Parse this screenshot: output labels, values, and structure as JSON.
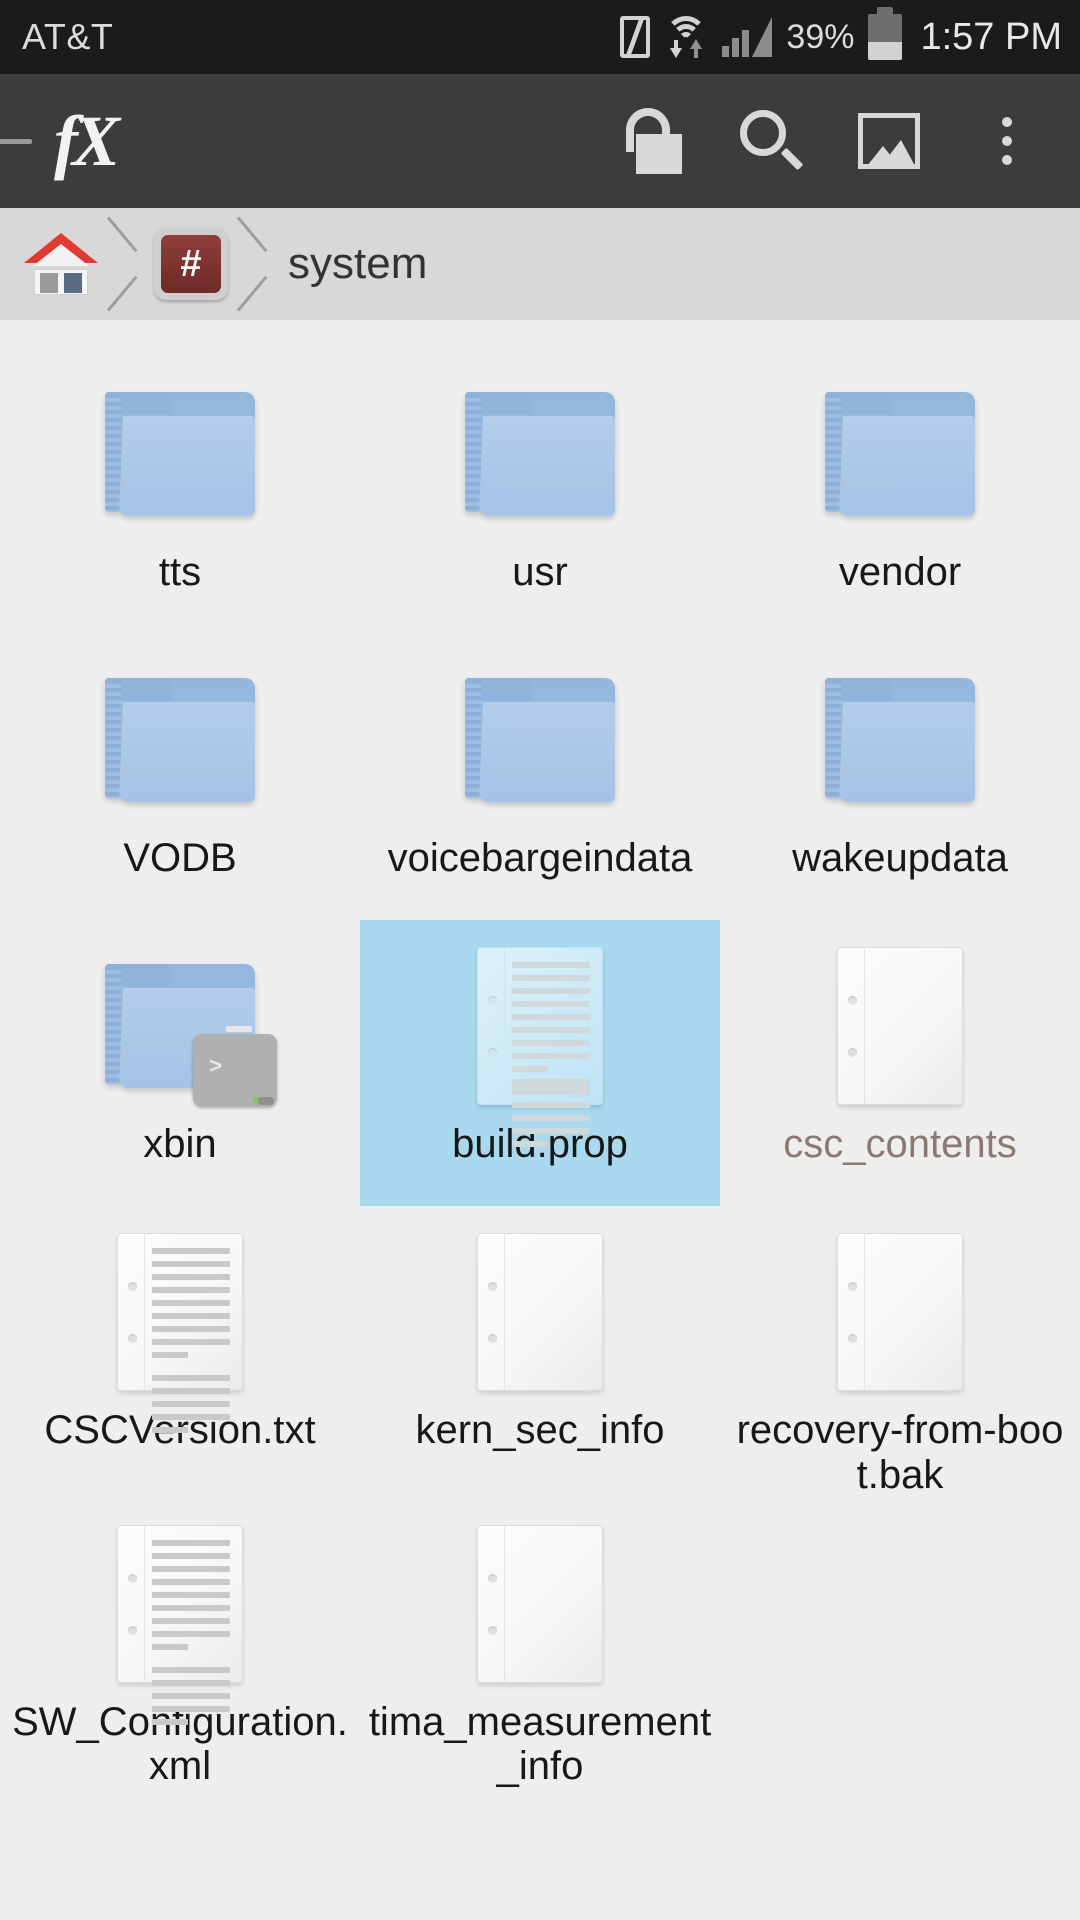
{
  "status_bar": {
    "carrier": "AT&T",
    "battery_percent_label": "39%",
    "battery_level": 39,
    "time": "1:57 PM",
    "icons": [
      "nfc-icon",
      "wifi-icon",
      "signal-icon",
      "battery-icon"
    ]
  },
  "toolbar": {
    "app_logo": "fX",
    "buttons": [
      {
        "name": "unlock-root-button",
        "icon": "unlock-icon"
      },
      {
        "name": "search-button",
        "icon": "search-icon"
      },
      {
        "name": "image-view-button",
        "icon": "image-icon"
      },
      {
        "name": "overflow-menu-button",
        "icon": "overflow-menu-icon"
      }
    ]
  },
  "breadcrumb": {
    "items": [
      {
        "name": "home-crumb",
        "icon": "home-icon",
        "label": ""
      },
      {
        "name": "root-crumb",
        "icon": "root-hash-icon",
        "label": "#"
      },
      {
        "name": "system-crumb",
        "icon": "",
        "label": "system"
      }
    ],
    "current_path_label": "system"
  },
  "colors": {
    "selection": "#a8d9ee",
    "status_bar": "#1b1b1b",
    "toolbar": "#3c3c3c",
    "breadcrumb": "#d8d8d8",
    "content_bg": "#eeeeee",
    "symlink_text": "#8a7a72"
  },
  "files": [
    {
      "name": "tts",
      "type": "folder",
      "selected": false,
      "muted": false
    },
    {
      "name": "usr",
      "type": "folder",
      "selected": false,
      "muted": false
    },
    {
      "name": "vendor",
      "type": "folder",
      "selected": false,
      "muted": false
    },
    {
      "name": "VODB",
      "type": "folder",
      "selected": false,
      "muted": false
    },
    {
      "name": "voicebargeindata",
      "type": "folder",
      "selected": false,
      "muted": false
    },
    {
      "name": "wakeupdata",
      "type": "folder",
      "selected": false,
      "muted": false
    },
    {
      "name": "xbin",
      "type": "folder-terminal",
      "selected": false,
      "muted": false
    },
    {
      "name": "build.prop",
      "type": "document-text",
      "selected": true,
      "muted": false
    },
    {
      "name": "csc_contents",
      "type": "document-blank",
      "selected": false,
      "muted": true
    },
    {
      "name": "CSCVersion.txt",
      "type": "document-text",
      "selected": false,
      "muted": false
    },
    {
      "name": "kern_sec_info",
      "type": "document-blank",
      "selected": false,
      "muted": false
    },
    {
      "name": "recovery-from-boot.bak",
      "type": "document-blank",
      "selected": false,
      "muted": false
    },
    {
      "name": "SW_Configuration.xml",
      "type": "document-text",
      "selected": false,
      "muted": false
    },
    {
      "name": "tima_measurement_info",
      "type": "document-blank",
      "selected": false,
      "muted": false
    }
  ]
}
